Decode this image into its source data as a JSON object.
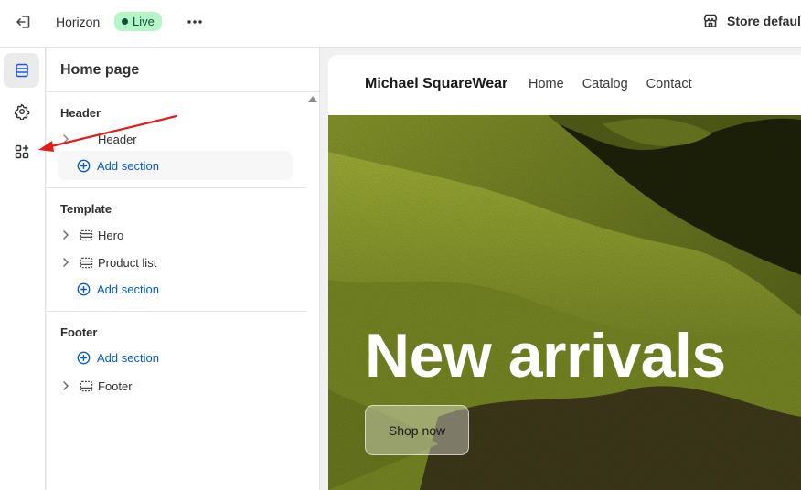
{
  "topbar": {
    "theme_name": "Horizon",
    "live_badge": "Live",
    "store_default": "Store default",
    "icons": [
      "exit-icon",
      "more-icon",
      "store-icon"
    ]
  },
  "rail": {
    "items": [
      {
        "name": "sections",
        "icon": "layout-sections-icon",
        "active": true
      },
      {
        "name": "settings",
        "icon": "gear-icon",
        "active": false
      },
      {
        "name": "apps",
        "icon": "apps-add-icon",
        "active": false
      }
    ]
  },
  "panel": {
    "title": "Home page",
    "groups": {
      "header": {
        "title": "Header",
        "items": [
          "Header"
        ],
        "add_label": "Add section"
      },
      "template": {
        "title": "Template",
        "items": [
          "Hero",
          "Product list"
        ],
        "add_label": "Add section"
      },
      "footer": {
        "title": "Footer",
        "add_label": "Add section",
        "items": [
          "Footer"
        ]
      }
    }
  },
  "preview": {
    "store_name": "Michael SquareWear",
    "nav": [
      "Home",
      "Catalog",
      "Contact"
    ],
    "hero_heading": "New arrivals",
    "hero_button": "Shop now"
  },
  "colors": {
    "accent_blue": "#005bd3",
    "live_bg": "#b5f5c8",
    "live_text": "#0c5132",
    "annotation_red": "#e51c1c"
  }
}
